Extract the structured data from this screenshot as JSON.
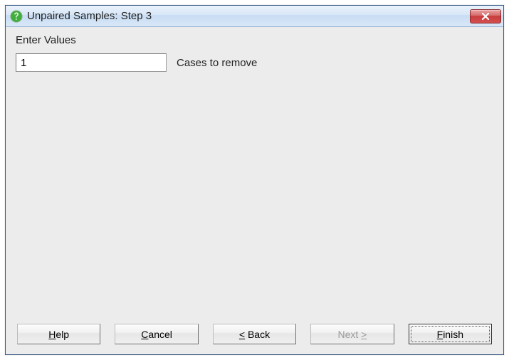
{
  "window": {
    "title": "Unpaired Samples: Step 3"
  },
  "content": {
    "section_label": "Enter Values",
    "cases_input_value": "1",
    "cases_label": "Cases to remove"
  },
  "buttons": {
    "help": {
      "pre": "",
      "mn": "H",
      "post": "elp"
    },
    "cancel": {
      "pre": "",
      "mn": "C",
      "post": "ancel"
    },
    "back": {
      "pre": "",
      "mn": "<",
      "post": " Back"
    },
    "next": {
      "pre": "Next ",
      "mn": ">",
      "post": ""
    },
    "finish": {
      "pre": "",
      "mn": "F",
      "post": "inish"
    }
  }
}
